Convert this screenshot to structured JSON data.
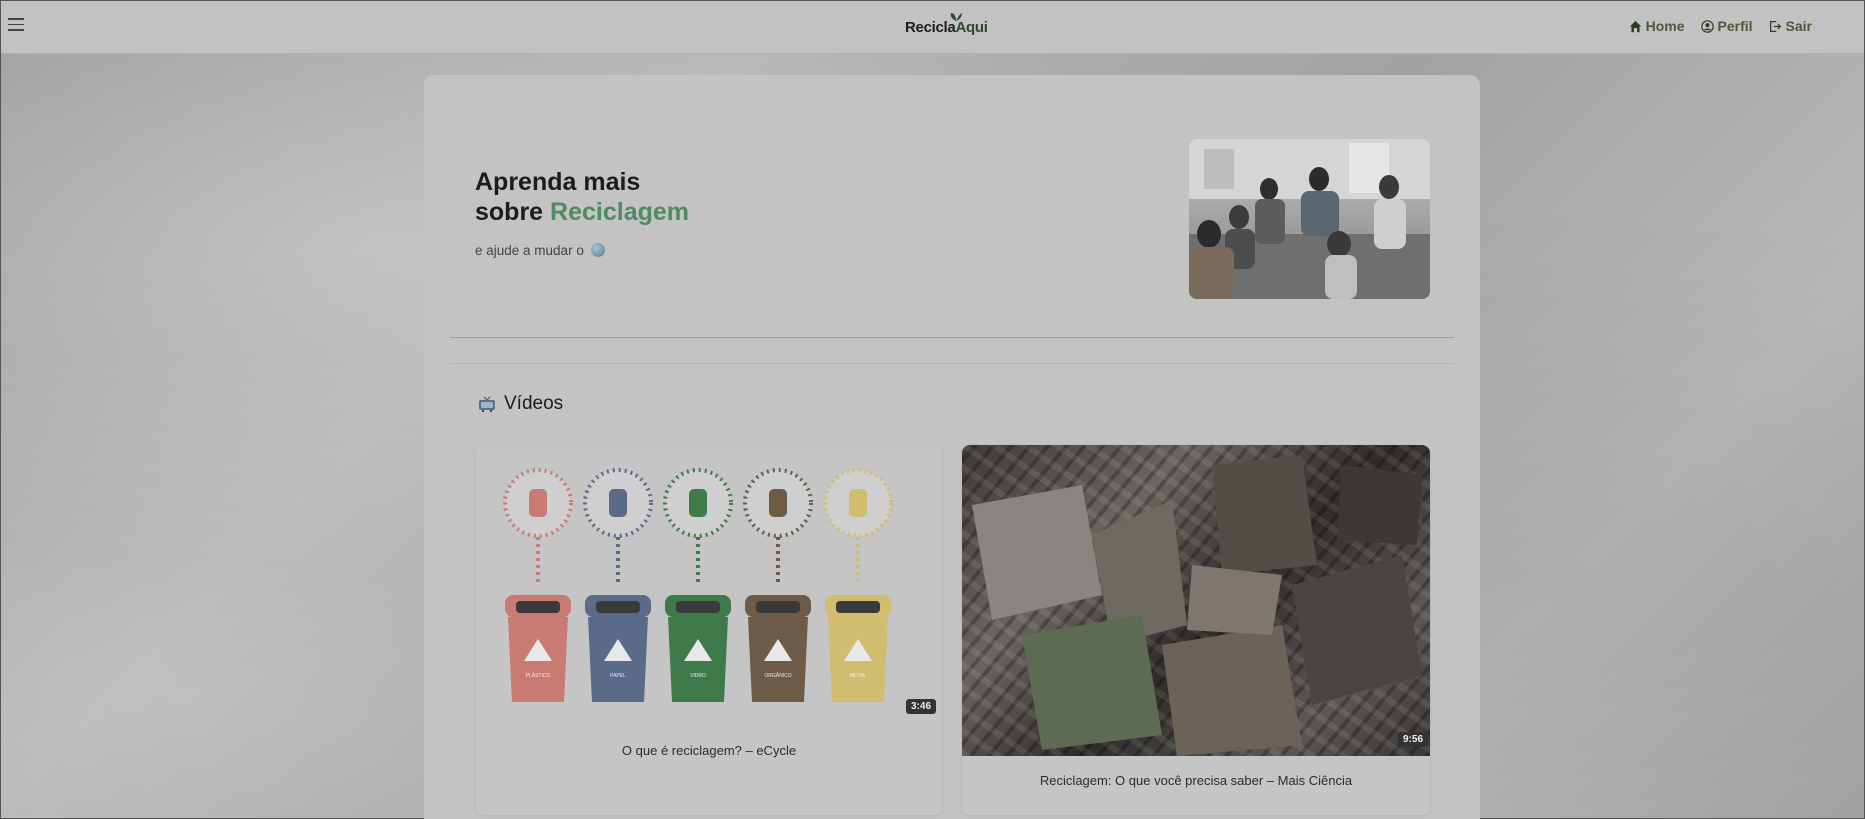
{
  "header": {
    "menu_icon": "hamburger-icon",
    "brand": {
      "part1": "Recicla",
      "part2": "Aqui",
      "leaf_icon": "leaf-icon"
    },
    "nav": [
      {
        "label": "Home",
        "icon": "home-icon"
      },
      {
        "label": "Perfil",
        "icon": "user-circle-icon"
      },
      {
        "label": "Sair",
        "icon": "logout-icon"
      }
    ]
  },
  "hero": {
    "title_line1": "Aprenda mais",
    "title_prefix": "sobre ",
    "title_highlight": "Reciclagem",
    "subtitle": "e ajude a mudar o",
    "globe_icon": "globe-icon"
  },
  "videos": {
    "section_title": "Vídeos",
    "section_icon": "tv-icon",
    "items": [
      {
        "title": "O que é reciclagem? – eCycle",
        "duration": "3:46",
        "bins": [
          "PLÁSTICO",
          "PAPEL",
          "VIDRO",
          "ORGÂNICO",
          "METAL"
        ],
        "bin_colors": [
          "#c97a73",
          "#5b6a88",
          "#3f7a4b",
          "#6d5b48",
          "#d1bd70"
        ]
      },
      {
        "title": "Reciclagem: O que você precisa saber – Mais Ciência",
        "duration": "9:56"
      }
    ]
  },
  "colors": {
    "accent_green": "#4e8a62",
    "nav_text": "#4d5a3a"
  }
}
